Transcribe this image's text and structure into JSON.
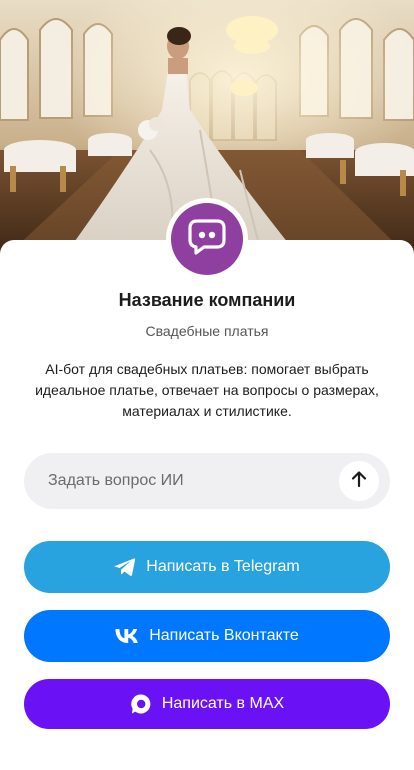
{
  "hero": {
    "image": "wedding-dress-ballroom-photo"
  },
  "company": {
    "name": "Название компании",
    "category": "Свадебные платья",
    "description": "AI-бот для свадебных платьев: помогает выбрать идеальное платье, отвечает на вопросы о размерах, материалах и стилистике.",
    "avatar_icon": "chat-bubble-icon",
    "avatar_color": "#8e3fa0"
  },
  "ask": {
    "placeholder": "Задать вопрос ИИ",
    "send_icon": "arrow-up-icon"
  },
  "buttons": {
    "telegram": {
      "label": "Написать в Telegram",
      "icon": "telegram-icon",
      "color": "#29a3e0"
    },
    "vk": {
      "label": "Написать Вконтакте",
      "icon": "vk-icon",
      "color": "#0077ff"
    },
    "max": {
      "label": "Написать в MAX",
      "icon": "max-icon",
      "color": "#6a11f5"
    }
  }
}
